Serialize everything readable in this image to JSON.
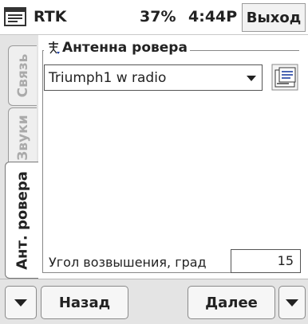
{
  "titlebar": {
    "app_title": "RTK",
    "battery": "37%",
    "time": "4:44P",
    "exit_label": "Выход",
    "start_icon": "windows-start-icon"
  },
  "tabs": [
    {
      "label": "Связь",
      "active": false
    },
    {
      "label": "Звуки",
      "active": false
    },
    {
      "label": "Ант. ровера",
      "active": true
    }
  ],
  "panel": {
    "group_title": "Антенна ровера",
    "group_icon": "antenna-icon",
    "antenna_select": {
      "value": "Triumph1 w radio",
      "icon": "chevron-down-icon"
    },
    "antenna_list_icon": "antenna-list-icon",
    "elevation_label": "Угол возвышения, град",
    "elevation_value": "15"
  },
  "footer": {
    "menu_left_icon": "triangle-down-icon",
    "back_label": "Назад",
    "next_label": "Далее",
    "menu_right_icon": "triangle-down-icon"
  },
  "colors": {
    "accent": "#1e3fa0",
    "tab_bg": "#e4e4e4"
  }
}
